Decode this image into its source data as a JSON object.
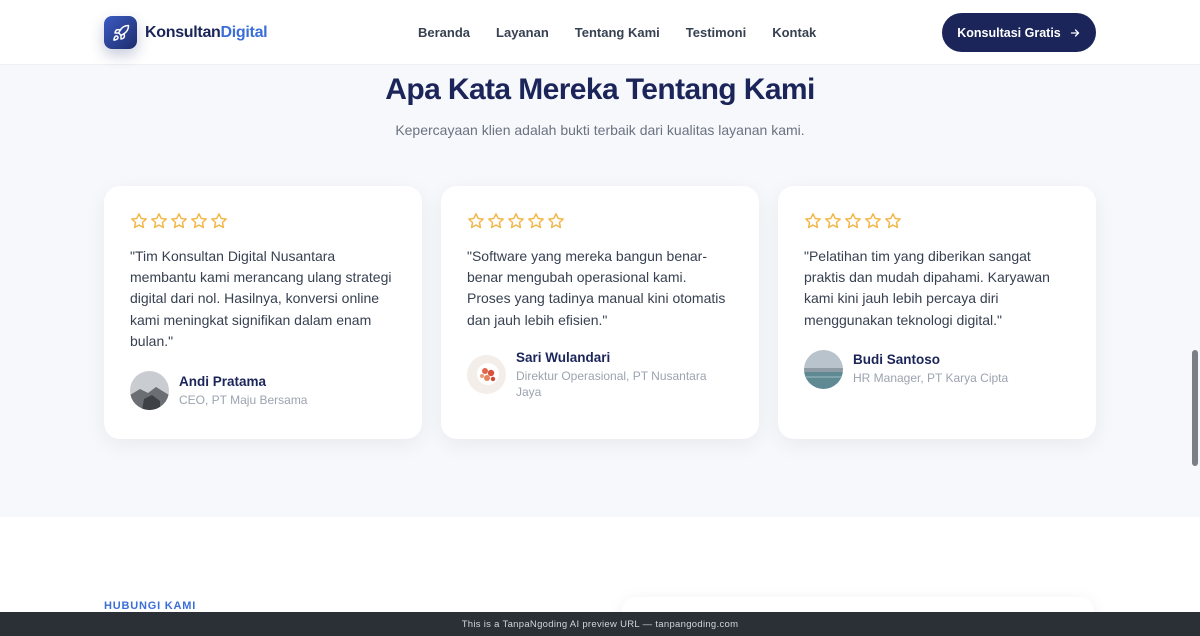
{
  "header": {
    "brand_part1": "Konsultan",
    "brand_part2": "Digital",
    "nav": [
      "Beranda",
      "Layanan",
      "Tentang Kami",
      "Testimoni",
      "Kontak"
    ],
    "cta_label": "Konsultasi Gratis"
  },
  "testimonials": {
    "title": "Apa Kata Mereka Tentang Kami",
    "subtitle": "Kepercayaan klien adalah bukti terbaik dari kualitas layanan kami.",
    "items": [
      {
        "stars": 5,
        "quote": "\"Tim Konsultan Digital Nusantara membantu kami merancang ulang strategi digital dari nol. Hasilnya, konversi online kami meningkat signifikan dalam enam bulan.\"",
        "name": "Andi Pratama",
        "role": "CEO, PT Maju Bersama"
      },
      {
        "stars": 5,
        "quote": "\"Software yang mereka bangun benar-benar mengubah operasional kami. Proses yang tadinya manual kini otomatis dan jauh lebih efisien.\"",
        "name": "Sari Wulandari",
        "role": "Direktur Operasional, PT Nusantara Jaya"
      },
      {
        "stars": 5,
        "quote": "\"Pelatihan tim yang diberikan sangat praktis dan mudah dipahami. Karyawan kami kini jauh lebih percaya diri menggunakan teknologi digital.\"",
        "name": "Budi Santoso",
        "role": "HR Manager, PT Karya Cipta"
      }
    ]
  },
  "contact": {
    "label": "HUBUNGI KAMI"
  },
  "preview_bar": {
    "text": "This is a TanpaNgoding AI preview URL — tanpangoding.com"
  },
  "colors": {
    "primary": "#1b2559",
    "accent": "#3b6fd8",
    "star": "#f2b84b",
    "section_bg": "#f6f8fb"
  },
  "icons": {
    "logo": "rocket-icon",
    "cta": "arrow-right-icon",
    "rating": "star-outline-icon"
  }
}
